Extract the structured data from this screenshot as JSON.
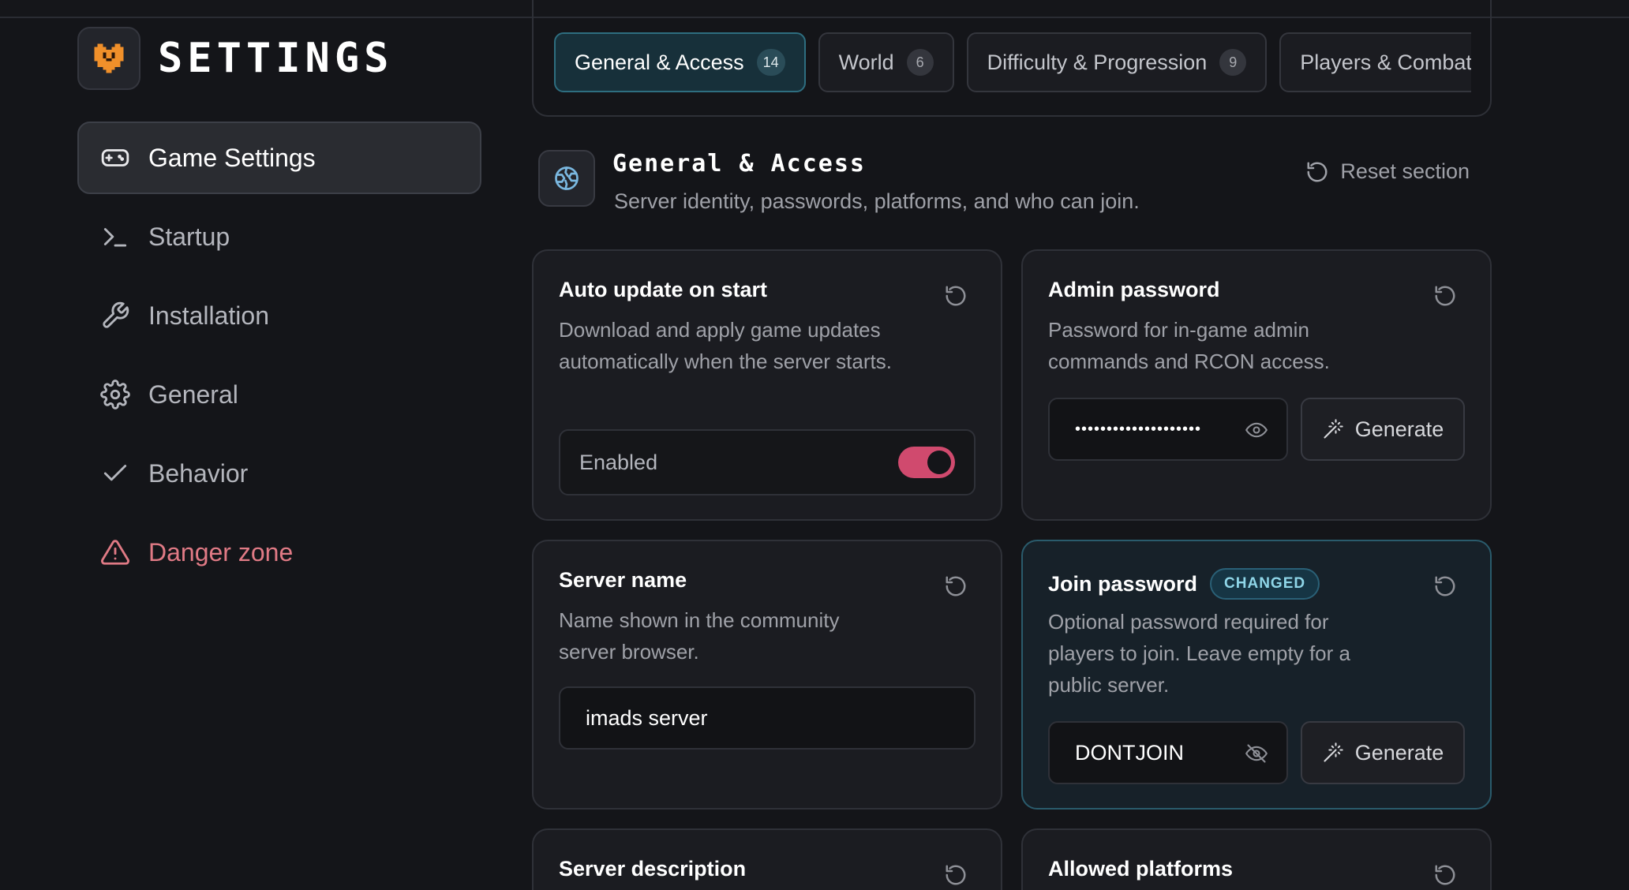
{
  "app": {
    "title": "SETTINGS",
    "logo_icon": "heart-shield-icon",
    "colors": {
      "accent": "#d04a6e",
      "brand": "#f0902a",
      "tab_active": "#2e6e80",
      "danger": "#e07a85"
    }
  },
  "sidebar": {
    "items": [
      {
        "label": "Game Settings",
        "icon": "gamepad-icon",
        "active": true
      },
      {
        "label": "Startup",
        "icon": "terminal-icon"
      },
      {
        "label": "Installation",
        "icon": "wrench-icon"
      },
      {
        "label": "General",
        "icon": "gear-icon"
      },
      {
        "label": "Behavior",
        "icon": "check-icon"
      },
      {
        "label": "Danger zone",
        "icon": "warning-icon",
        "danger": true
      }
    ]
  },
  "tabs": [
    {
      "label": "General & Access",
      "count": "14",
      "active": true
    },
    {
      "label": "World",
      "count": "6"
    },
    {
      "label": "Difficulty & Progression",
      "count": "9"
    },
    {
      "label": "Players & Combat",
      "count": ""
    }
  ],
  "section": {
    "title": "General & Access",
    "subtitle": "Server identity, passwords, platforms, and who can join.",
    "reset_label": "Reset section",
    "icon": "globe-icon"
  },
  "cards": {
    "auto_update": {
      "title": "Auto update on start",
      "description": "Download and apply game updates automatically when the server starts.",
      "toggle_label": "Enabled",
      "enabled": true
    },
    "admin_password": {
      "title": "Admin password",
      "description": "Password for in-game admin commands and RCON access.",
      "masked_value": "••••••••••••••••••••",
      "generate_label": "Generate"
    },
    "server_name": {
      "title": "Server name",
      "description": "Name shown in the community server browser.",
      "value": "imads server"
    },
    "join_password": {
      "title": "Join password",
      "badge": "CHANGED",
      "description": "Optional password required for players to join. Leave empty for a public server.",
      "value": "DONTJOIN",
      "generate_label": "Generate"
    },
    "server_description": {
      "title": "Server description"
    },
    "allowed_platforms": {
      "title": "Allowed platforms"
    }
  }
}
